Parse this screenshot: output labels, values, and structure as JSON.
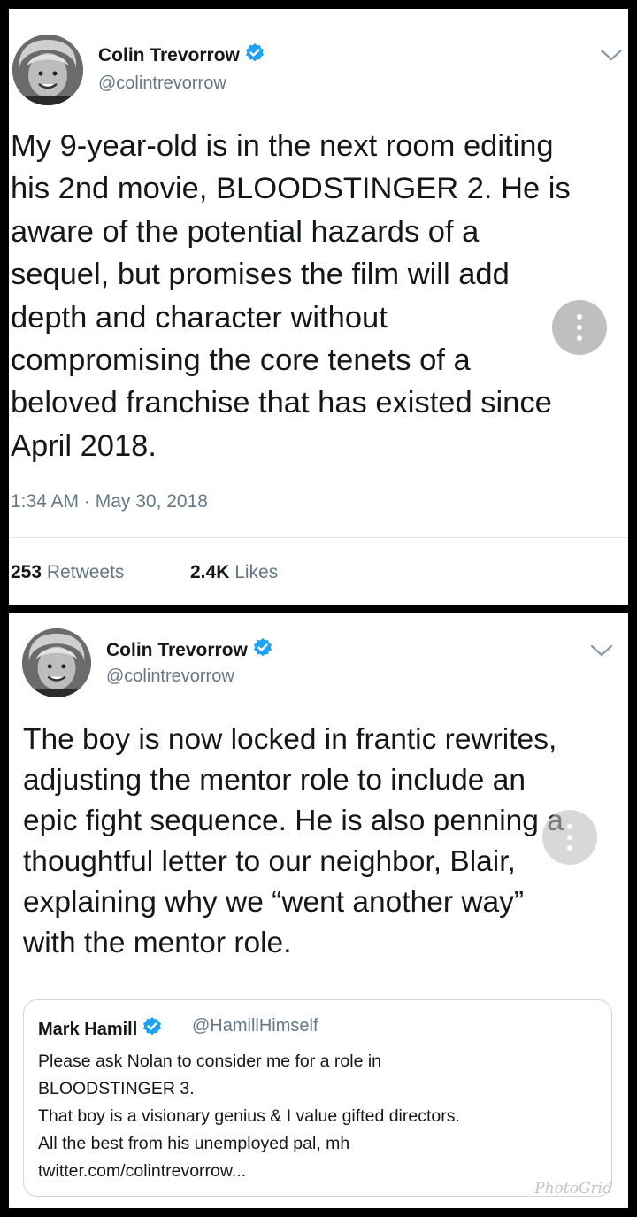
{
  "tweets": [
    {
      "author_name": "Colin Trevorrow",
      "author_handle": "@colintrevorrow",
      "verified": true,
      "text": "My 9-year-old is in the next room editing\nhis 2nd movie, BLOODSTINGER 2. He is\naware of the potential hazards of a\nsequel, but promises the film will add\ndepth and character without\ncompromising the core tenets of a\nbeloved franchise that has existed since\nApril 2018.",
      "timestamp": "1:34 AM · May 30, 2018",
      "retweets_count": "253",
      "retweets_label": "Retweets",
      "likes_count": "2.4K",
      "likes_label": "Likes"
    },
    {
      "author_name": "Colin Trevorrow",
      "author_handle": "@colintrevorrow",
      "verified": true,
      "text": "The boy is now locked in frantic rewrites,\nadjusting the mentor role to include an\nepic fight sequence. He is also penning a\nthoughtful letter to our neighbor, Blair,\nexplaining why we “went another way”\nwith the mentor role.",
      "quoted": {
        "author_name": "Mark Hamill",
        "author_handle": "@HamillHimself",
        "verified": true,
        "text": "Please ask Nolan to consider me for a role in\nBLOODSTINGER 3.\nThat boy is a visionary genius & I value gifted directors.\nAll the best from his unemployed pal, mh\ntwitter.com/colintrevorrow..."
      }
    }
  ],
  "watermark": "PhotoGrid",
  "icons": {
    "verified": "verified-badge-icon",
    "chevron": "chevron-down-icon",
    "more": "more-vertical-icon"
  },
  "colors": {
    "verified_blue": "#1da1f2",
    "secondary_text": "#657786",
    "primary_text": "#14171a",
    "divider": "#e1e8ed"
  }
}
